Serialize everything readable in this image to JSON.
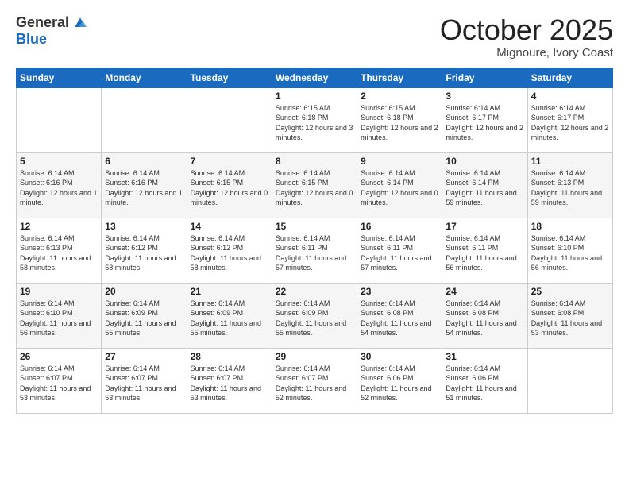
{
  "header": {
    "logo_general": "General",
    "logo_blue": "Blue",
    "month": "October 2025",
    "location": "Mignoure, Ivory Coast"
  },
  "weekdays": [
    "Sunday",
    "Monday",
    "Tuesday",
    "Wednesday",
    "Thursday",
    "Friday",
    "Saturday"
  ],
  "weeks": [
    [
      {
        "day": "",
        "info": ""
      },
      {
        "day": "",
        "info": ""
      },
      {
        "day": "",
        "info": ""
      },
      {
        "day": "1",
        "info": "Sunrise: 6:15 AM\nSunset: 6:18 PM\nDaylight: 12 hours and 3 minutes."
      },
      {
        "day": "2",
        "info": "Sunrise: 6:15 AM\nSunset: 6:18 PM\nDaylight: 12 hours and 2 minutes."
      },
      {
        "day": "3",
        "info": "Sunrise: 6:14 AM\nSunset: 6:17 PM\nDaylight: 12 hours and 2 minutes."
      },
      {
        "day": "4",
        "info": "Sunrise: 6:14 AM\nSunset: 6:17 PM\nDaylight: 12 hours and 2 minutes."
      }
    ],
    [
      {
        "day": "5",
        "info": "Sunrise: 6:14 AM\nSunset: 6:16 PM\nDaylight: 12 hours and 1 minute."
      },
      {
        "day": "6",
        "info": "Sunrise: 6:14 AM\nSunset: 6:16 PM\nDaylight: 12 hours and 1 minute."
      },
      {
        "day": "7",
        "info": "Sunrise: 6:14 AM\nSunset: 6:15 PM\nDaylight: 12 hours and 0 minutes."
      },
      {
        "day": "8",
        "info": "Sunrise: 6:14 AM\nSunset: 6:15 PM\nDaylight: 12 hours and 0 minutes."
      },
      {
        "day": "9",
        "info": "Sunrise: 6:14 AM\nSunset: 6:14 PM\nDaylight: 12 hours and 0 minutes."
      },
      {
        "day": "10",
        "info": "Sunrise: 6:14 AM\nSunset: 6:14 PM\nDaylight: 11 hours and 59 minutes."
      },
      {
        "day": "11",
        "info": "Sunrise: 6:14 AM\nSunset: 6:13 PM\nDaylight: 11 hours and 59 minutes."
      }
    ],
    [
      {
        "day": "12",
        "info": "Sunrise: 6:14 AM\nSunset: 6:13 PM\nDaylight: 11 hours and 58 minutes."
      },
      {
        "day": "13",
        "info": "Sunrise: 6:14 AM\nSunset: 6:12 PM\nDaylight: 11 hours and 58 minutes."
      },
      {
        "day": "14",
        "info": "Sunrise: 6:14 AM\nSunset: 6:12 PM\nDaylight: 11 hours and 58 minutes."
      },
      {
        "day": "15",
        "info": "Sunrise: 6:14 AM\nSunset: 6:11 PM\nDaylight: 11 hours and 57 minutes."
      },
      {
        "day": "16",
        "info": "Sunrise: 6:14 AM\nSunset: 6:11 PM\nDaylight: 11 hours and 57 minutes."
      },
      {
        "day": "17",
        "info": "Sunrise: 6:14 AM\nSunset: 6:11 PM\nDaylight: 11 hours and 56 minutes."
      },
      {
        "day": "18",
        "info": "Sunrise: 6:14 AM\nSunset: 6:10 PM\nDaylight: 11 hours and 56 minutes."
      }
    ],
    [
      {
        "day": "19",
        "info": "Sunrise: 6:14 AM\nSunset: 6:10 PM\nDaylight: 11 hours and 56 minutes."
      },
      {
        "day": "20",
        "info": "Sunrise: 6:14 AM\nSunset: 6:09 PM\nDaylight: 11 hours and 55 minutes."
      },
      {
        "day": "21",
        "info": "Sunrise: 6:14 AM\nSunset: 6:09 PM\nDaylight: 11 hours and 55 minutes."
      },
      {
        "day": "22",
        "info": "Sunrise: 6:14 AM\nSunset: 6:09 PM\nDaylight: 11 hours and 55 minutes."
      },
      {
        "day": "23",
        "info": "Sunrise: 6:14 AM\nSunset: 6:08 PM\nDaylight: 11 hours and 54 minutes."
      },
      {
        "day": "24",
        "info": "Sunrise: 6:14 AM\nSunset: 6:08 PM\nDaylight: 11 hours and 54 minutes."
      },
      {
        "day": "25",
        "info": "Sunrise: 6:14 AM\nSunset: 6:08 PM\nDaylight: 11 hours and 53 minutes."
      }
    ],
    [
      {
        "day": "26",
        "info": "Sunrise: 6:14 AM\nSunset: 6:07 PM\nDaylight: 11 hours and 53 minutes."
      },
      {
        "day": "27",
        "info": "Sunrise: 6:14 AM\nSunset: 6:07 PM\nDaylight: 11 hours and 53 minutes."
      },
      {
        "day": "28",
        "info": "Sunrise: 6:14 AM\nSunset: 6:07 PM\nDaylight: 11 hours and 53 minutes."
      },
      {
        "day": "29",
        "info": "Sunrise: 6:14 AM\nSunset: 6:07 PM\nDaylight: 11 hours and 52 minutes."
      },
      {
        "day": "30",
        "info": "Sunrise: 6:14 AM\nSunset: 6:06 PM\nDaylight: 11 hours and 52 minutes."
      },
      {
        "day": "31",
        "info": "Sunrise: 6:14 AM\nSunset: 6:06 PM\nDaylight: 11 hours and 51 minutes."
      },
      {
        "day": "",
        "info": ""
      }
    ]
  ]
}
